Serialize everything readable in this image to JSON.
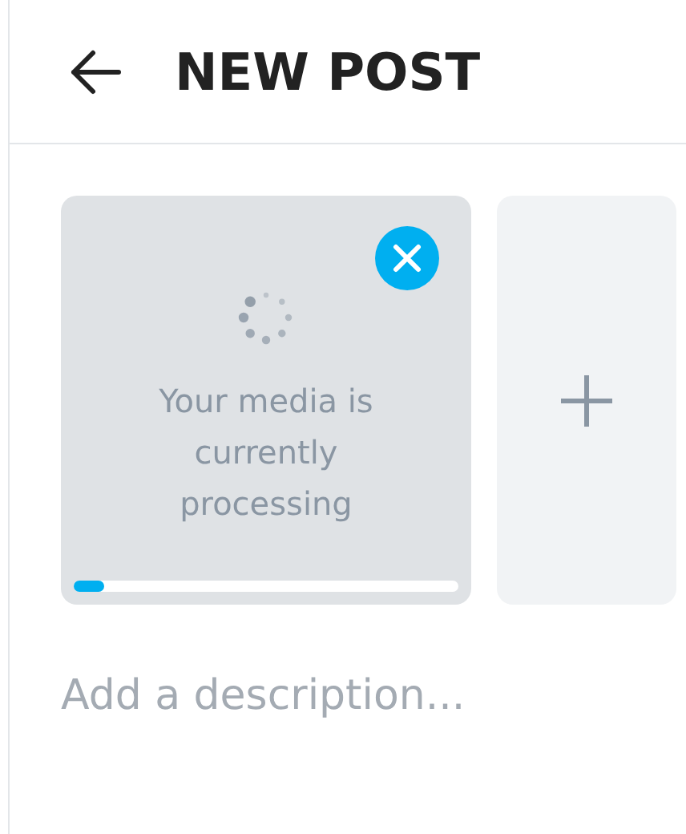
{
  "header": {
    "title": "NEW POST"
  },
  "media": [
    {
      "kind": "processing",
      "message": "Your media is currently processing",
      "level": 0.08,
      "removable": true
    },
    {
      "kind": "add"
    }
  ],
  "description": {
    "placeholder": "Add a description..."
  }
}
